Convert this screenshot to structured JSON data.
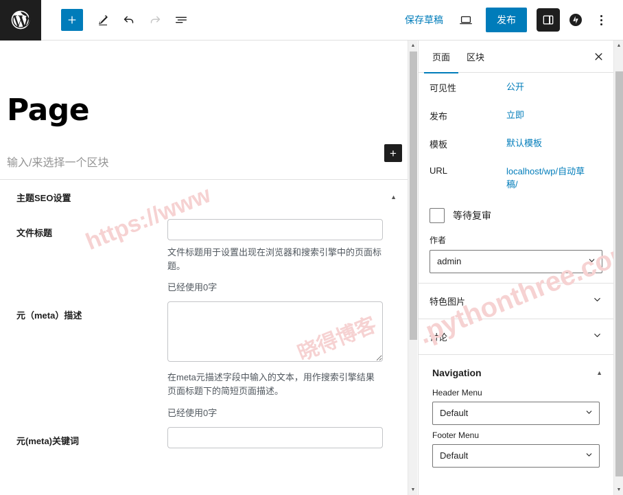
{
  "topbar": {
    "logo_icon": "wordpress-logo-icon",
    "add_block_label": "+",
    "add_block_icon": "plus-icon",
    "edit_icon": "pencil-icon",
    "undo_icon": "undo-icon",
    "redo_icon": "redo-icon",
    "list_view_icon": "list-view-icon",
    "save_draft_label": "保存草稿",
    "preview_icon": "laptop-preview-icon",
    "publish_label": "发布",
    "sidebar_toggle_icon": "sidebar-toggle-icon",
    "jetpack_icon": "jetpack-icon",
    "options_icon": "kebab-menu-icon"
  },
  "editor": {
    "title": "Page",
    "block_placeholder": "输入/来选择一个区块",
    "inserter_label": "+",
    "seo_box": {
      "title": "主题SEO设置",
      "collapse_icon": "chevron-up-icon",
      "fields": [
        {
          "label": "文件标题",
          "value": "",
          "type": "input",
          "help": "文件标题用于设置出现在浏览器和搜索引擎中的页面标题。",
          "count": "已经使用0字"
        },
        {
          "label": "元（meta）描述",
          "value": "",
          "type": "textarea",
          "help": "在meta元描述字段中输入的文本，用作搜索引擎结果页面标题下的简短页面描述。",
          "count": "已经使用0字"
        },
        {
          "label": "元(meta)关键词",
          "value": "",
          "type": "input",
          "help": "",
          "count": ""
        }
      ]
    }
  },
  "sidebar": {
    "tabs": [
      {
        "label": "页面",
        "active": true
      },
      {
        "label": "区块",
        "active": false
      }
    ],
    "close_icon": "close-icon",
    "status_rows": [
      {
        "key": "可见性",
        "value": "公开"
      },
      {
        "key": "发布",
        "value": "立即"
      },
      {
        "key": "模板",
        "value": "默认模板"
      },
      {
        "key": "URL",
        "value": "localhost/wp/自动草稿/"
      }
    ],
    "pending_review": {
      "label": "等待复审",
      "checked": false
    },
    "author": {
      "label": "作者",
      "value": "admin",
      "options": [
        "admin"
      ]
    },
    "panels": [
      {
        "title": "特色图片",
        "expanded": false,
        "chevron": "chevron-down-icon"
      },
      {
        "title": "讨论",
        "expanded": false,
        "chevron": "chevron-down-icon"
      }
    ],
    "navigation": {
      "title": "Navigation",
      "chevron": "chevron-up-icon",
      "header_menu": {
        "label": "Header Menu",
        "value": "Default",
        "options": [
          "Default"
        ]
      },
      "footer_menu": {
        "label": "Footer Menu",
        "value": "Default",
        "options": [
          "Default"
        ]
      }
    }
  },
  "scrollbars": {
    "main": {
      "up_icon": "scroll-up-arrow",
      "down_icon": "scroll-down-arrow"
    },
    "sidebar": {
      "up_icon": "scroll-up-arrow",
      "down_icon": "scroll-down-arrow"
    }
  },
  "watermarks": {
    "one": "https://www",
    "two": ".pythonthree.com",
    "three": "晓得博客"
  },
  "colors": {
    "accent": "#007cba",
    "dark": "#1e1e1e",
    "border": "#e0e0e0",
    "muted": "#50575e"
  }
}
